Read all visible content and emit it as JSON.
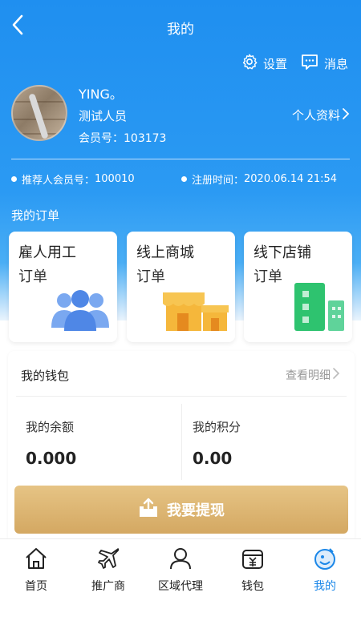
{
  "header": {
    "title": "我的"
  },
  "tools": {
    "settings": "设置",
    "messages": "消息"
  },
  "user": {
    "name": "YING。",
    "role": "测试人员",
    "member_label": "会员号：",
    "member_no": "103173",
    "profile_link": "个人资料"
  },
  "info": {
    "referrer_label": "推荐人会员号：",
    "referrer_no": "100010",
    "register_label": "注册时间：",
    "register_time": "2020.06.14 21:54"
  },
  "orders": {
    "section_label": "我的订单",
    "cards": [
      {
        "title": "雇人用工",
        "subtitle": "订单",
        "icon": "people-icon"
      },
      {
        "title": "线上商城",
        "subtitle": "订单",
        "icon": "shop-icon"
      },
      {
        "title": "线下店铺",
        "subtitle": "订单",
        "icon": "building-icon"
      }
    ]
  },
  "wallet": {
    "title": "我的钱包",
    "detail_link": "查看明细",
    "balance_label": "我的余额",
    "balance_value": "0.000",
    "points_label": "我的积分",
    "points_value": "0.00",
    "withdraw_label": "我要提现"
  },
  "tabbar": {
    "items": [
      {
        "label": "首页",
        "icon": "home-icon"
      },
      {
        "label": "推广商",
        "icon": "airplane-icon"
      },
      {
        "label": "区域代理",
        "icon": "person-icon"
      },
      {
        "label": "钱包",
        "icon": "wallet-icon"
      },
      {
        "label": "我的",
        "icon": "mine-icon",
        "active": true
      }
    ]
  },
  "colors": {
    "primary": "#1f8ff0",
    "gold": "#d4a862",
    "active_tab": "#1b87e8"
  }
}
